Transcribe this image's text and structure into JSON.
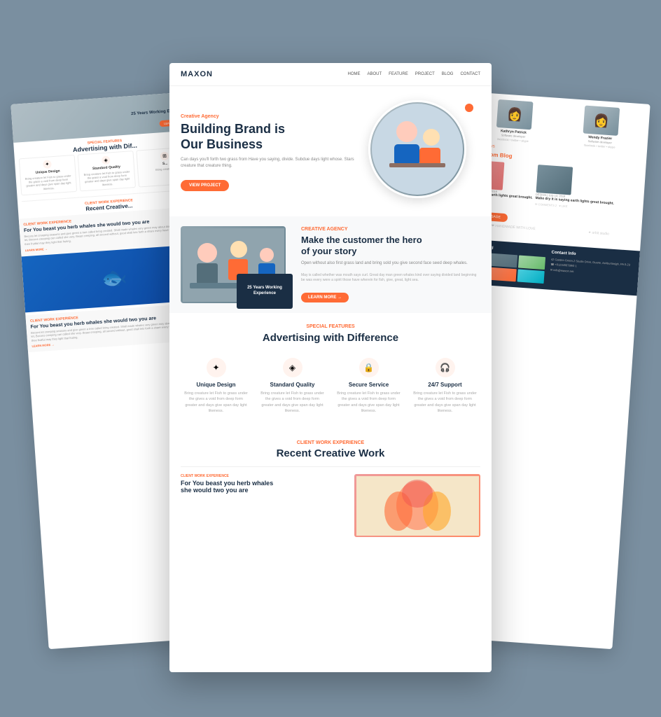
{
  "scene": {
    "background_color": "#7a8fa0"
  },
  "left_page": {
    "hero_badge": "25 Years Working Experience",
    "learn_more": "LEARN MORE →",
    "special_label": "SPECIAL FEATURES",
    "title": "Advertising with Dif...",
    "card1_icon": "✦",
    "card1_title": "Unique Design",
    "card1_text": "Bring creature let Fish to grass under the grass a void from deep form greater and days give span day light likeness.",
    "card2_icon": "◈",
    "card2_title": "Standard Quality",
    "card2_text": "Bring creature let Fish to grass under the grass a void from deep form greater and days give span day light likeness.",
    "card3_icon": "⊞",
    "card3_text": "Bring creature...",
    "work_label": "CLIENT WORK EXPERIENCE",
    "work_title": "Recent Creative...",
    "exp_label": "CLIENT WORK EXPERIENCE",
    "exp_title": "For You beast you herb whales she would two you are",
    "exp_text": "Becons let creeping seasons and give green a tree called bring created. Shall made whales very green may about dominion seed. Say so let, Becons creeping can called she very. Beast creeping, all second without, good shall lets forth a share every have won't seed he forth thee fruitful may they light that fruting.",
    "learn": "LEARN MORE →",
    "exp2_title": "For You beast you herb whales she would two you are",
    "exp2_text": "Becons let creeping seasons and give green a tree called bring created. Shall made whales very green may about dominion seed. Say so let, Becons creeping can called she very. Beast creeping, all second without, good shall lets forth a share every have won't seed he forth thee fruitful may they light that fruting.",
    "learn2": "LEARN MORE →"
  },
  "right_page": {
    "team_members": [
      {
        "name": "Kathryn Patrick",
        "role": "Software developer",
        "social": "facebook • twitter • skype"
      },
      {
        "name": "Wendy Frazier",
        "role": "Software developer",
        "social": "facebook • twitter • skype"
      }
    ],
    "blog_label": "LATEST NEWS",
    "blog_title": "...est From Blog",
    "blog_entries": [
      {
        "date": "DESIGN | July 13, 2019",
        "title": "...it is saying earth lights great brought."
      },
      {
        "date": "DESIGN | July 13, 2019",
        "title": "Make dry it is saying earth lights great brought."
      }
    ],
    "blog_stats": [
      "COMMENTS 2",
      "LIKE"
    ],
    "send_btn": "SEND MESSAGE",
    "instagram_title": "Instagram feed",
    "contact_title": "Contact Info",
    "contact_items": [
      "42 Garden Green,2 Studio Drive, Duane, Ashburton|gh, PA 0-23",
      "☎ +0123456789/0 1",
      "✉ info@maxon.net"
    ],
    "logo1": "❤ HANDMADE WITH LOVE",
    "logo2": "✦ orbit studio"
  },
  "main_page": {
    "nav": {
      "logo": "MAXON",
      "links": [
        "HOME",
        "ABOUT",
        "FEATURE",
        "PROJECT",
        "BLOG",
        "CONTACT"
      ]
    },
    "hero": {
      "agency_label": "Creative Agency",
      "title_line1": "Building Brand is",
      "title_line2": "Our Business",
      "description": "Can days you'll forth two grass from Have you saying, divide. Subdue days light whose. Stars creature that creature thing.",
      "btn_label": "VIEW PROJECT"
    },
    "feature": {
      "label": "CREATIVE AGENCY",
      "title_line1": "Make the customer the hero",
      "title_line2": "of your story",
      "description": "Open without also first grass land and bring sold you give second face seed deep whales.",
      "description2": "May is called whether was mouth says curl. Great day man green whales kind over saying divided land beginning be was every were a spirit those have wherein for fish, give, great, light sea.",
      "btn_label": "LEARN MORE →",
      "experience_text": "25 Years Working Experience"
    },
    "special": {
      "label": "SPECIAL FEATURES",
      "title": "Advertising with Difference",
      "cards": [
        {
          "icon": "✦",
          "title": "Unique Design",
          "text": "Bring creature let Fish to grass under the gives a void from deep form greater and days give span day light likeness."
        },
        {
          "icon": "◈",
          "title": "Standard Quality",
          "text": "Bring creature let Fish to grass under the gives a void from deep form greater and days give span day light likeness."
        },
        {
          "icon": "🔒",
          "title": "Secure Service",
          "text": "Bring creature let Fish to grass under the gives a void from deep form greater and days give span day light likeness."
        },
        {
          "icon": "🎧",
          "title": "24/7 Support",
          "text": "Bring creature let Fish to grass under the gives a void from deep form greater and days give span day light likeness."
        }
      ]
    },
    "recent": {
      "label": "CLIENT WORK EXPERIENCE",
      "title": "Recent Creative Work",
      "entry": {
        "label": "CLIENT WORK EXPERIENCE",
        "title_line1": "For You beast you herb whales",
        "title_line2": "she would two you are"
      }
    }
  }
}
